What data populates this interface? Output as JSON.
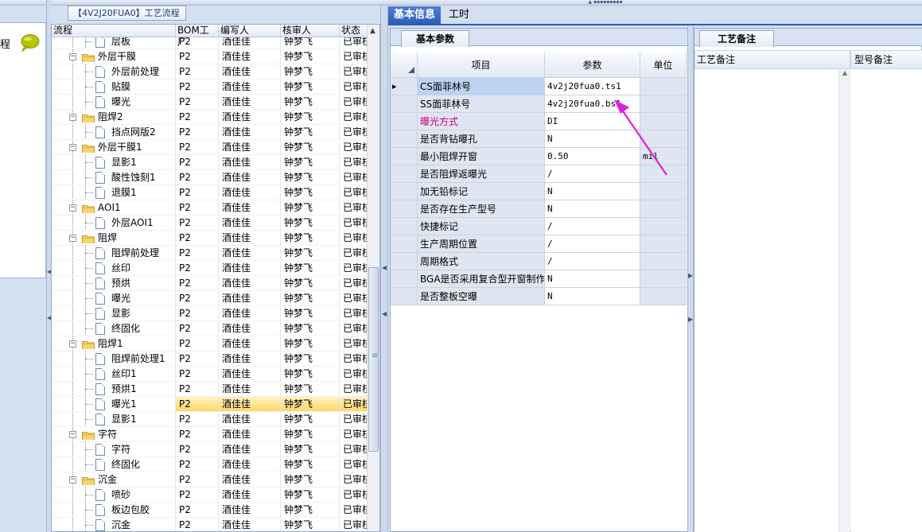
{
  "top_grip": "▲ ▪▪▪▪▪▪▪▪▪",
  "left_panel": {
    "label_fragment": "程"
  },
  "tree_panel": {
    "tab_title": "【4V2J20FUA0】工艺流程",
    "columns": [
      "流程",
      "BOM工厂",
      "编写人",
      "核审人",
      "状态"
    ],
    "rows": [
      {
        "name": "层板",
        "level": 2,
        "bom": "P2",
        "writer": "酒佳佳",
        "reviewer": "钟梦飞",
        "status": "已审核"
      },
      {
        "name": "外层干膜",
        "level": 1,
        "bom": "P2",
        "writer": "酒佳佳",
        "reviewer": "钟梦飞",
        "status": "已审核"
      },
      {
        "name": "外层前处理",
        "level": 2,
        "bom": "P2",
        "writer": "酒佳佳",
        "reviewer": "钟梦飞",
        "status": "已审核"
      },
      {
        "name": "贴膜",
        "level": 2,
        "bom": "P2",
        "writer": "酒佳佳",
        "reviewer": "钟梦飞",
        "status": "已审核"
      },
      {
        "name": "曝光",
        "level": 2,
        "bom": "P2",
        "writer": "酒佳佳",
        "reviewer": "钟梦飞",
        "status": "已审核"
      },
      {
        "name": "阻焊2",
        "level": 1,
        "bom": "P2",
        "writer": "酒佳佳",
        "reviewer": "钟梦飞",
        "status": "已审核"
      },
      {
        "name": "挡点网版2",
        "level": 2,
        "bom": "P2",
        "writer": "酒佳佳",
        "reviewer": "钟梦飞",
        "status": "已审核"
      },
      {
        "name": "外层干膜1",
        "level": 1,
        "bom": "P2",
        "writer": "酒佳佳",
        "reviewer": "钟梦飞",
        "status": "已审核"
      },
      {
        "name": "显影1",
        "level": 2,
        "bom": "P2",
        "writer": "酒佳佳",
        "reviewer": "钟梦飞",
        "status": "已审核"
      },
      {
        "name": "酸性蚀刻1",
        "level": 2,
        "bom": "P2",
        "writer": "酒佳佳",
        "reviewer": "钟梦飞",
        "status": "已审核"
      },
      {
        "name": "退膜1",
        "level": 2,
        "bom": "P2",
        "writer": "酒佳佳",
        "reviewer": "钟梦飞",
        "status": "已审核"
      },
      {
        "name": "AOI1",
        "level": 1,
        "bom": "P2",
        "writer": "酒佳佳",
        "reviewer": "钟梦飞",
        "status": "已审核"
      },
      {
        "name": "外层AOI1",
        "level": 2,
        "bom": "P2",
        "writer": "酒佳佳",
        "reviewer": "钟梦飞",
        "status": "已审核"
      },
      {
        "name": "阻焊",
        "level": 1,
        "bom": "P2",
        "writer": "酒佳佳",
        "reviewer": "钟梦飞",
        "status": "已审核"
      },
      {
        "name": "阻焊前处理",
        "level": 2,
        "bom": "P2",
        "writer": "酒佳佳",
        "reviewer": "钟梦飞",
        "status": "已审核"
      },
      {
        "name": "丝印",
        "level": 2,
        "bom": "P2",
        "writer": "酒佳佳",
        "reviewer": "钟梦飞",
        "status": "已审核"
      },
      {
        "name": "预烘",
        "level": 2,
        "bom": "P2",
        "writer": "酒佳佳",
        "reviewer": "钟梦飞",
        "status": "已审核"
      },
      {
        "name": "曝光",
        "level": 2,
        "bom": "P2",
        "writer": "酒佳佳",
        "reviewer": "钟梦飞",
        "status": "已审核"
      },
      {
        "name": "显影",
        "level": 2,
        "bom": "P2",
        "writer": "酒佳佳",
        "reviewer": "钟梦飞",
        "status": "已审核"
      },
      {
        "name": "终固化",
        "level": 2,
        "bom": "P2",
        "writer": "酒佳佳",
        "reviewer": "钟梦飞",
        "status": "已审核"
      },
      {
        "name": "阻焊1",
        "level": 1,
        "bom": "P2",
        "writer": "酒佳佳",
        "reviewer": "钟梦飞",
        "status": "已审核"
      },
      {
        "name": "阻焊前处理1",
        "level": 2,
        "bom": "P2",
        "writer": "酒佳佳",
        "reviewer": "钟梦飞",
        "status": "已审核"
      },
      {
        "name": "丝印1",
        "level": 2,
        "bom": "P2",
        "writer": "酒佳佳",
        "reviewer": "钟梦飞",
        "status": "已审核"
      },
      {
        "name": "预烘1",
        "level": 2,
        "bom": "P2",
        "writer": "酒佳佳",
        "reviewer": "钟梦飞",
        "status": "已审核"
      },
      {
        "name": "曝光1",
        "level": 2,
        "bom": "P2",
        "writer": "酒佳佳",
        "reviewer": "钟梦飞",
        "status": "已审核",
        "selected": true
      },
      {
        "name": "显影1",
        "level": 2,
        "bom": "P2",
        "writer": "酒佳佳",
        "reviewer": "钟梦飞",
        "status": "已审核"
      },
      {
        "name": "字符",
        "level": 1,
        "bom": "P2",
        "writer": "酒佳佳",
        "reviewer": "钟梦飞",
        "status": "已审核"
      },
      {
        "name": "字符",
        "level": 2,
        "bom": "P2",
        "writer": "酒佳佳",
        "reviewer": "钟梦飞",
        "status": "已审核"
      },
      {
        "name": "终固化",
        "level": 2,
        "bom": "P2",
        "writer": "酒佳佳",
        "reviewer": "钟梦飞",
        "status": "已审核"
      },
      {
        "name": "沉金",
        "level": 1,
        "bom": "P2",
        "writer": "酒佳佳",
        "reviewer": "钟梦飞",
        "status": "已审核"
      },
      {
        "name": "喷砂",
        "level": 2,
        "bom": "P2",
        "writer": "酒佳佳",
        "reviewer": "钟梦飞",
        "status": "已审核"
      },
      {
        "name": "板边包胶",
        "level": 2,
        "bom": "P2",
        "writer": "酒佳佳",
        "reviewer": "钟梦飞",
        "status": "已审核"
      },
      {
        "name": "沉金",
        "level": 2,
        "bom": "P2",
        "writer": "酒佳佳",
        "reviewer": "钟梦飞",
        "status": "已审核"
      }
    ]
  },
  "tabs": {
    "basic_info": "基本信息",
    "hours": "工时"
  },
  "params_panel": {
    "tab_title": "基本参数",
    "columns": {
      "item": "项目",
      "param": "参数",
      "unit": "单位"
    },
    "rows": [
      {
        "item": "CS面菲林号",
        "value": "4v2j20fua0.ts1",
        "unit": "",
        "current": true
      },
      {
        "item": "SS面菲林号",
        "value": "4v2j20fua0.bs1",
        "unit": ""
      },
      {
        "item": "曝光方式",
        "value": "DI",
        "unit": "",
        "highlight": "#c0007a"
      },
      {
        "item": "是否背钻曝孔",
        "value": "N",
        "unit": ""
      },
      {
        "item": "最小阻焊开窗",
        "value": "0.50",
        "unit": "mil"
      },
      {
        "item": "是否阻焊返曝光",
        "value": "/",
        "unit": ""
      },
      {
        "item": "加无铅标记",
        "value": "N",
        "unit": ""
      },
      {
        "item": "是否存在生产型号",
        "value": "N",
        "unit": ""
      },
      {
        "item": "快捷标记",
        "value": "/",
        "unit": ""
      },
      {
        "item": "生产周期位置",
        "value": "/",
        "unit": ""
      },
      {
        "item": "周期格式",
        "value": "/",
        "unit": ""
      },
      {
        "item": "BGA是否采用复合型开窗制作",
        "value": "N",
        "unit": ""
      },
      {
        "item": "是否整板空曝",
        "value": "N",
        "unit": ""
      }
    ]
  },
  "remarks_panel": {
    "tab_title": "工艺备注",
    "col_process": "工艺备注",
    "col_model": "型号备注"
  },
  "colors": {
    "accent": "#2e5fb8",
    "annotation_arrow": "#e01fe0",
    "selected_row": "#ffd66a"
  }
}
